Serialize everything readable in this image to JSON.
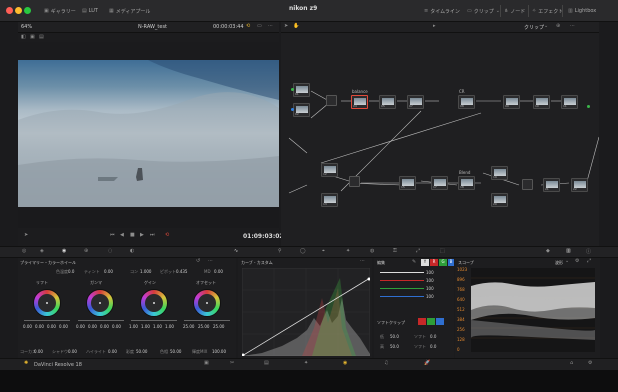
{
  "window": {
    "title": "nikon z9"
  },
  "topbar": {
    "gallery": "ギャラリー",
    "lut": "LUT",
    "media_pool": "メディアプール",
    "timeline": "タイムライン",
    "clip": "クリップ",
    "nodes": "ノード",
    "effects": "エフェクト",
    "lightbox": "Lightbox"
  },
  "viewer": {
    "zoom": "64%",
    "clip_name": "N-RAW_test",
    "timecode_top": "00:00:03:44",
    "timecode_bottom": "01:09:03:02"
  },
  "node_editor": {
    "mode": "クリップ",
    "nodes": [
      {
        "id": "01",
        "label": ""
      },
      {
        "id": "02",
        "label": ""
      },
      {
        "id": "04",
        "label": "balance"
      },
      {
        "id": "05",
        "label": ""
      },
      {
        "id": "07",
        "label": ""
      },
      {
        "id": "08",
        "label": "CR"
      },
      {
        "id": "09",
        "label": ""
      },
      {
        "id": "10",
        "label": ""
      },
      {
        "id": "11",
        "label": ""
      },
      {
        "id": "12",
        "label": ""
      },
      {
        "id": "13",
        "label": ""
      },
      {
        "id": "15",
        "label": ""
      },
      {
        "id": "17",
        "label": ""
      },
      {
        "id": "18",
        "label": "Blend"
      },
      {
        "id": "19",
        "label": ""
      },
      {
        "id": "20",
        "label": ""
      },
      {
        "id": "21",
        "label": ""
      },
      {
        "id": "22",
        "label": ""
      }
    ]
  },
  "wheels_panel": {
    "title": "プライマリー・カラーホイール",
    "top_controls": [
      {
        "label": "色温度",
        "value": "0.0"
      },
      {
        "label": "ティント",
        "value": "0.00"
      },
      {
        "label": "コン",
        "value": "1.000"
      },
      {
        "label": "ピボット",
        "value": "0.435"
      },
      {
        "label": "MD",
        "value": "0.00"
      }
    ],
    "wheels": [
      {
        "name": "リフト",
        "values": [
          "0.00",
          "0.00",
          "0.00",
          "0.00"
        ]
      },
      {
        "name": "ガンマ",
        "values": [
          "0.00",
          "0.00",
          "0.00",
          "0.00"
        ]
      },
      {
        "name": "ゲイン",
        "values": [
          "1.00",
          "1.00",
          "1.00",
          "1.00"
        ]
      },
      {
        "name": "オフセット",
        "values": [
          "25.00",
          "25.00",
          "25.00"
        ]
      }
    ],
    "bottom_controls": [
      {
        "label": "コーカス",
        "value": "0.00"
      },
      {
        "label": "シャドウ",
        "value": "0.00"
      },
      {
        "label": "ハイライト",
        "value": "0.00"
      },
      {
        "label": "彩度",
        "value": "50.00"
      },
      {
        "label": "色相",
        "value": "50.00"
      },
      {
        "label": "輝度MIX",
        "value": "100.00"
      }
    ]
  },
  "curves_panel": {
    "title": "カーブ - カスタム"
  },
  "mixer_panel": {
    "title": "編集",
    "channels": [
      "Y",
      "R",
      "G",
      "B"
    ],
    "rows": [
      "100",
      "100",
      "100",
      "100"
    ],
    "soft_clip_title": "ソフトクリップ",
    "soft_clip": [
      {
        "label": "低",
        "value": "50.0"
      },
      {
        "label": "ソフト",
        "value": "0.0"
      },
      {
        "label": "高",
        "value": "50.0"
      },
      {
        "label": "ソフト",
        "value": "0.0"
      }
    ]
  },
  "scope_panel": {
    "title": "スコープ",
    "mode": "波形",
    "scale": [
      "1023",
      "896",
      "768",
      "640",
      "512",
      "384",
      "256",
      "128",
      "0"
    ]
  },
  "footer": {
    "app_name": "DaVinci Resolve 18"
  },
  "colors": {
    "accent_red": "#e04a3a",
    "accent_green": "#3bb54a",
    "accent_blue": "#2f7fe0",
    "accent_orange": "#e68a2e"
  }
}
